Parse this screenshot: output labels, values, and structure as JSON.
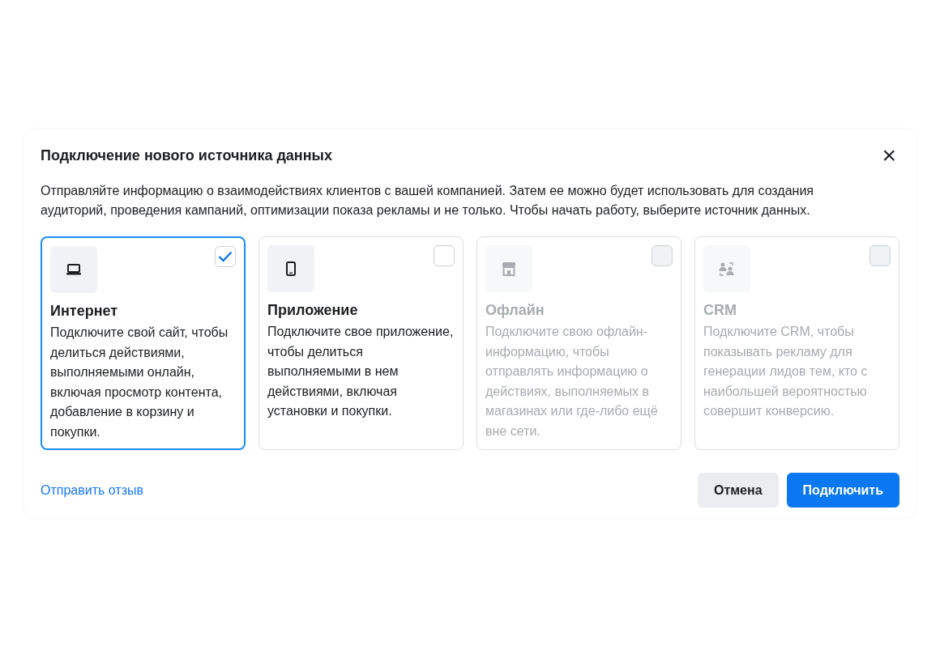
{
  "dialog": {
    "title": "Подключение нового источника данных",
    "close": "×",
    "description": "Отправляйте информацию о взаимодействиях клиентов с вашей компанией. Затем ее можно будет использовать для создания аудиторий, проведения кампаний, оптимизации показа рекламы и не только. Чтобы начать работу, выберите источник данных.",
    "sources": [
      {
        "kind": "laptop",
        "title": "Интернет",
        "text": "Подключите свой сайт, чтобы делиться действиями, выполняемыми онлайн, включая просмотр контента, добавление в корзину и покупки.",
        "selected": true,
        "disabled": false
      },
      {
        "kind": "phone",
        "title": "Приложение",
        "text": "Подключите свое приложение, чтобы делиться выполняемыми в нем действиями, включая установки и покупки.",
        "selected": false,
        "disabled": false
      },
      {
        "kind": "store",
        "title": "Офлайн",
        "text": "Подключите свою офлайн-информацию, чтобы отправлять информацию о действиях, выполняемых в магазинах или где-либо ещё вне сети.",
        "selected": false,
        "disabled": true
      },
      {
        "kind": "people",
        "title": "CRM",
        "text": "Подключите CRM, чтобы показывать рекламу для генерации лидов тем, кто с наибольшей вероятностью совершит конверсию.",
        "selected": false,
        "disabled": true
      }
    ],
    "feedback_link": "Отправить отзыв",
    "cancel_button": "Отмена",
    "connect_button": "Подключить"
  }
}
